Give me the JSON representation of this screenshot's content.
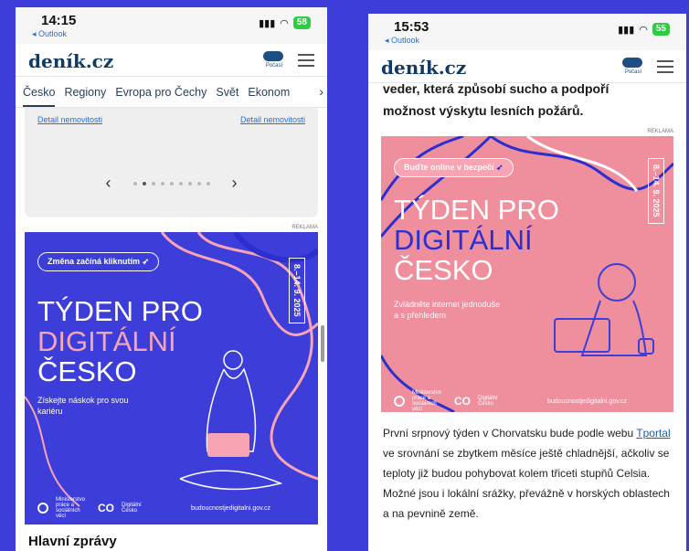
{
  "phone1": {
    "status": {
      "time": "14:15",
      "back": "◂ Outlook",
      "battery": "58"
    },
    "logo": "deník.cz",
    "weather_label": "Počasí",
    "tabs": [
      "Česko",
      "Regiony",
      "Evropa pro Čechy",
      "Svět",
      "Ekonom"
    ],
    "carousel": {
      "link_left": "Detail nemovitosti",
      "link_right": "Detail nemovitosti",
      "page_count": 9,
      "active_index": 1
    },
    "ad": {
      "label": "REKLAMA",
      "pill": "Změna začíná kliknutím",
      "dates": "8.–14. 9. 2025",
      "headline_1": "TÝDEN PRO",
      "headline_2": "DIGITÁLNÍ",
      "headline_3": "ČESKO",
      "subtext": "Získejte náskok pro svou kariéru",
      "org1": "Ministerstvo práce a sociálních věcí",
      "org2": "Digitální Česko",
      "url": "budoucnostjedigitalni.gov.cz"
    },
    "section_title": "Hlavní zprávy"
  },
  "phone2": {
    "status": {
      "time": "15:53",
      "back": "◂ Outlook",
      "battery": "55"
    },
    "logo": "deník.cz",
    "weather_label": "Počasí",
    "article_top_1": "veder, která způsobí sucho a podpoří",
    "article_top_2": "možnost výskytu lesních požárů.",
    "ad": {
      "label": "REKLAMA",
      "pill": "Buďte online v bezpečí",
      "dates": "8.–14. 9. 2025",
      "headline_1": "TÝDEN PRO",
      "headline_2": "DIGITÁLNÍ",
      "headline_3": "ČESKO",
      "subtext": "Zvládněte internet jednoduše a s přehledem",
      "org1": "Ministerstvo práce a sociálních věcí",
      "org2": "Digitální Česko",
      "url": "budoucnostjedigitalni.gov.cz"
    },
    "body_pre": "První srpnový týden v Chorvatsku bude podle webu ",
    "body_link": "Tportal",
    "body_post": " ve srovnání se zbytkem měsíce ještě chladnější, ačkoliv se teploty již budou pohybovat kolem třiceti stupňů Celsia. Možné jsou i lokální srážky, převážně v horských oblastech a na pevnině země."
  },
  "colors": {
    "ad1_bg": "#3d3ed9",
    "ad2_bg": "#ef8f9e",
    "accent_pink": "#f7a4b4",
    "accent_blue": "#2b2fd0",
    "navy": "#123a63"
  },
  "icons": [
    "weather-cloud-icon",
    "hamburger-menu-icon",
    "chevron-left-icon",
    "chevron-right-icon",
    "cursor-icon",
    "signal-icon",
    "wifi-icon",
    "battery-icon"
  ]
}
